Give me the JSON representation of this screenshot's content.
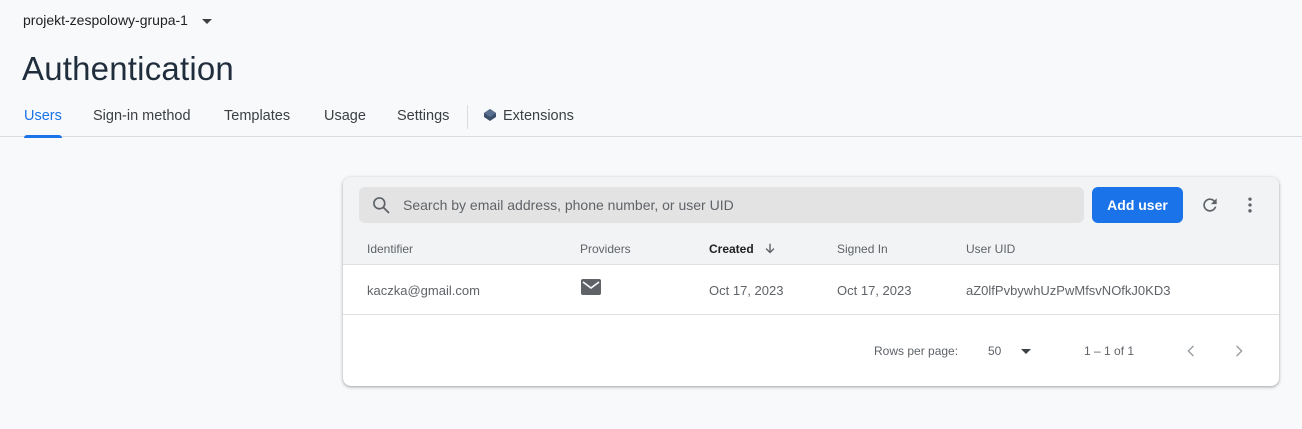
{
  "project": {
    "name": "projekt-zespolowy-grupa-1"
  },
  "page": {
    "title": "Authentication"
  },
  "tabs": [
    {
      "label": "Users"
    },
    {
      "label": "Sign-in method"
    },
    {
      "label": "Templates"
    },
    {
      "label": "Usage"
    },
    {
      "label": "Settings"
    },
    {
      "label": "Extensions"
    }
  ],
  "users_table": {
    "search_placeholder": "Search by email address, phone number, or user UID",
    "add_user_label": "Add user",
    "columns": [
      "Identifier",
      "Providers",
      "Created",
      "Signed In",
      "User UID"
    ],
    "sorted_column": "Created",
    "rows": [
      {
        "identifier": "kaczka@gmail.com",
        "provider_icon": "email-icon",
        "created": "Oct 17, 2023",
        "signed_in": "Oct 17, 2023",
        "uid": "aZ0lfPvbywhUzPwMfsvNOfkJ0KD3"
      }
    ],
    "pagination": {
      "rows_per_page_label": "Rows per page:",
      "rows_per_page": "50",
      "range": "1 – 1 of 1"
    }
  },
  "colors": {
    "accent": "#1a73e8",
    "title": "#1f2d3d",
    "background": "#f8f9fa"
  }
}
